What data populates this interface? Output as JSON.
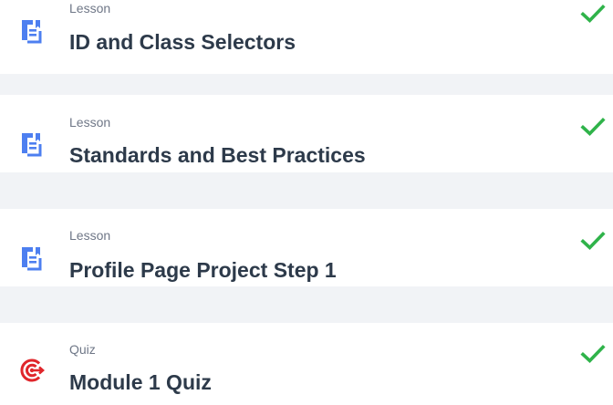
{
  "colors": {
    "page_background": "#f1f3f6",
    "card_background": "#ffffff",
    "lesson_icon": "#4d7ff0",
    "quiz_icon": "#e0262b",
    "check": "#2fb34a",
    "title_text": "#2d3a4a",
    "label_text": "#6f7787"
  },
  "items": [
    {
      "type_label": "Lesson",
      "title": "ID and Class Selectors",
      "icon": "lesson-document-icon",
      "completed": true,
      "status_icon": "checkmark-icon"
    },
    {
      "type_label": "Lesson",
      "title": "Standards and Best Practices",
      "icon": "lesson-document-icon",
      "completed": true,
      "status_icon": "checkmark-icon"
    },
    {
      "type_label": "Lesson",
      "title": "Profile Page Project Step 1",
      "icon": "lesson-document-icon",
      "completed": true,
      "status_icon": "checkmark-icon"
    },
    {
      "type_label": "Quiz",
      "title": "Module 1 Quiz",
      "icon": "quiz-target-icon",
      "completed": true,
      "status_icon": "checkmark-icon"
    }
  ]
}
